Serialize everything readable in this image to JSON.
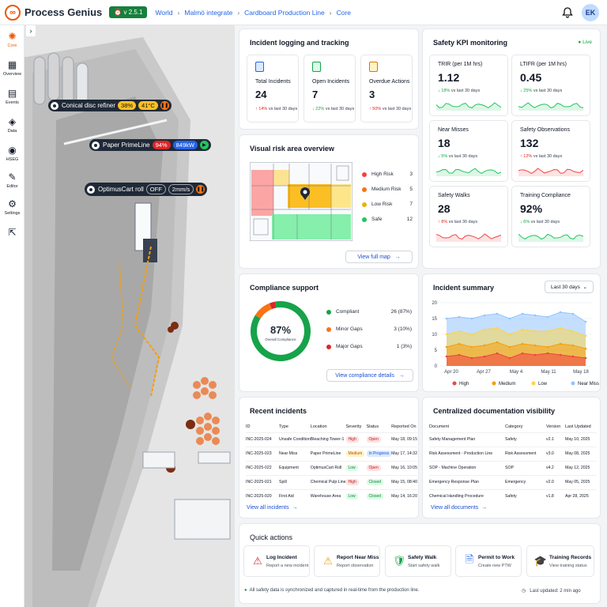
{
  "app": {
    "name": "Process Genius",
    "version": "v 2.5.1",
    "avatar": "EK"
  },
  "breadcrumb": [
    "World",
    "Malmö integrate",
    "Cardboard Production Line",
    "Core"
  ],
  "sidebar": [
    {
      "label": "Core",
      "icon": "core-icon"
    },
    {
      "label": "Overview",
      "icon": "overview-icon"
    },
    {
      "label": "Events",
      "icon": "calendar-icon"
    },
    {
      "label": "Data",
      "icon": "database-icon"
    },
    {
      "label": "HSEG",
      "icon": "hseg-icon"
    },
    {
      "label": "Editor",
      "icon": "wrench-icon"
    },
    {
      "label": "Settings",
      "icon": "settings-icon"
    },
    {
      "label": "",
      "icon": "external-link-icon"
    }
  ],
  "map": {
    "overlays": [
      {
        "name": "Conical disc refiner",
        "chips": [
          "38%",
          "41°C"
        ],
        "control": "pause"
      },
      {
        "name": "Paper PrimeLine",
        "chips": [
          "94%",
          "849kW"
        ],
        "control": "play"
      },
      {
        "name": "OptimusCart roll",
        "chips": [
          "OFF",
          "2mm/s"
        ],
        "control": "pause"
      }
    ]
  },
  "incident_logging": {
    "title": "Incident logging and tracking",
    "kpis": [
      {
        "label": "Total Incidents",
        "value": "24",
        "trend": "14%",
        "direction": "up",
        "period": "vs last 30 days"
      },
      {
        "label": "Open Incidents",
        "value": "7",
        "trend": "22%",
        "direction": "down",
        "period": "vs last 30 days"
      },
      {
        "label": "Overdue Actions",
        "value": "3",
        "trend": "50%",
        "direction": "up",
        "period": "vs last 30 days"
      }
    ]
  },
  "safety_kpi": {
    "title": "Safety KPI monitoring",
    "status": "Live",
    "kpis": [
      {
        "label": "TRIR (per 1M hrs)",
        "value": "1.12",
        "trend": "18%",
        "direction": "down",
        "period": "vs last 30 days"
      },
      {
        "label": "LTIFR (per 1M hrs)",
        "value": "0.45",
        "trend": "25%",
        "direction": "down",
        "period": "vs last 30 days"
      },
      {
        "label": "Near Misses",
        "value": "18",
        "trend": "5%",
        "direction": "down",
        "period": "vs last 30 days"
      },
      {
        "label": "Safety Observations",
        "value": "132",
        "trend": "12%",
        "direction": "up",
        "period": "vs last 30 days"
      },
      {
        "label": "Safety Walks",
        "value": "28",
        "trend": "8%",
        "direction": "up",
        "period": "vs last 30 days"
      },
      {
        "label": "Training Compliance",
        "value": "92%",
        "trend": "6%",
        "direction": "down",
        "period": "vs last 30 days"
      }
    ]
  },
  "risk": {
    "title": "Visual risk area overview",
    "legend": [
      {
        "label": "High Risk",
        "count": "3",
        "color": "#ef4444"
      },
      {
        "label": "Medium Risk",
        "count": "5",
        "color": "#f97316"
      },
      {
        "label": "Low Risk",
        "count": "7",
        "color": "#eab308"
      },
      {
        "label": "Safe",
        "count": "12",
        "color": "#22c55e"
      }
    ],
    "button": "View full map"
  },
  "compliance": {
    "title": "Compliance support",
    "percent": "87%",
    "percent_label": "Overall Compliance",
    "rows": [
      {
        "label": "Compliant",
        "value": "26 (87%)",
        "color": "#16a34a"
      },
      {
        "label": "Minor Gaps",
        "value": "3 (10%)",
        "color": "#f97316"
      },
      {
        "label": "Major Gaps",
        "value": "1 (3%)",
        "color": "#dc2626"
      }
    ],
    "button": "View compliance details",
    "chart_data": {
      "type": "pie",
      "categories": [
        "Compliant",
        "Minor Gaps",
        "Major Gaps"
      ],
      "values": [
        87,
        10,
        3
      ]
    }
  },
  "incident_summary": {
    "title": "Incident summary",
    "range": "Last 30 days",
    "chart_data": {
      "type": "area",
      "categories": [
        "Apr 20",
        "Apr 27",
        "May 4",
        "May 11",
        "May 18"
      ],
      "ylim": [
        0,
        20
      ],
      "yticks": [
        "0",
        "5",
        "10",
        "15",
        "20"
      ],
      "series": [
        {
          "name": "High",
          "color": "#ef4444",
          "values": [
            3,
            3.5,
            2.5,
            3,
            4,
            2.5,
            4,
            3.5,
            4,
            3.5,
            3,
            2.5
          ]
        },
        {
          "name": "Medium",
          "color": "#f59e0b",
          "values": [
            6,
            7,
            6,
            6.5,
            7.5,
            6,
            7,
            6.5,
            6,
            7,
            6.5,
            5.5
          ]
        },
        {
          "name": "Low",
          "color": "#fcd34d",
          "values": [
            10,
            11,
            10,
            11.5,
            12,
            10,
            11.5,
            11,
            11,
            12,
            11,
            9.5
          ]
        },
        {
          "name": "Near Miss",
          "color": "#93c5fd",
          "values": [
            15,
            15.5,
            15,
            16,
            16.5,
            15,
            16.5,
            16,
            15.5,
            17,
            16.5,
            14
          ]
        }
      ]
    }
  },
  "recent": {
    "title": "Recent incidents",
    "columns": [
      "ID",
      "Type",
      "Location",
      "Severity",
      "Status",
      "Reported On"
    ],
    "rows": [
      [
        "INC-2025-024",
        "Unsafe Condition",
        "Bleaching Tower-1",
        "High",
        "Open",
        "May 18, 09:15"
      ],
      [
        "INC-2025-023",
        "Near Miss",
        "Paper PrimeLine",
        "Medium",
        "In Progress",
        "May 17, 14:32"
      ],
      [
        "INC-2025-022",
        "Equipment",
        "OptimusCart Roll",
        "Low",
        "Open",
        "May 16, 10:05"
      ],
      [
        "INC-2025-021",
        "Spill",
        "Chemical Pulp Line",
        "High",
        "Closed",
        "May 15, 08:40"
      ],
      [
        "INC-2025-020",
        "First Aid",
        "Warehouse Area",
        "Low",
        "Closed",
        "May 14, 16:20"
      ]
    ],
    "link": "View all incidents"
  },
  "docs": {
    "title": "Centralized documentation visibility",
    "columns": [
      "Document",
      "Category",
      "Version",
      "Last Updated"
    ],
    "rows": [
      [
        "Safety Management Plan",
        "Safety",
        "v2.1",
        "May 10, 2025"
      ],
      [
        "Risk Assessment - Production Line",
        "Risk Assessment",
        "v3.0",
        "May 08, 2025"
      ],
      [
        "SOP - Machine Operation",
        "SOP",
        "v4.2",
        "May 12, 2025"
      ],
      [
        "Emergency Response Plan",
        "Emergency",
        "v2.0",
        "May 05, 2025"
      ],
      [
        "Chemical Handling Procedure",
        "Safety",
        "v1.8",
        "Apr 28, 2025"
      ]
    ],
    "link": "View all documents"
  },
  "quick": {
    "title": "Quick actions",
    "items": [
      {
        "title": "Log Incident",
        "sub": "Report a new incident",
        "icon": "warning-icon"
      },
      {
        "title": "Report Near Miss",
        "sub": "Report observation",
        "icon": "caution-icon"
      },
      {
        "title": "Safety Walk",
        "sub": "Start safety walk",
        "icon": "walk-icon"
      },
      {
        "title": "Permit to Work",
        "sub": "Create new PTW",
        "icon": "document-icon"
      },
      {
        "title": "Training Records",
        "sub": "View training status",
        "icon": "graduation-icon"
      }
    ]
  },
  "footer": {
    "sync": "All safety data is synchronized and captured in real-time from the production line.",
    "updated": "Last updated: 2 min ago"
  }
}
